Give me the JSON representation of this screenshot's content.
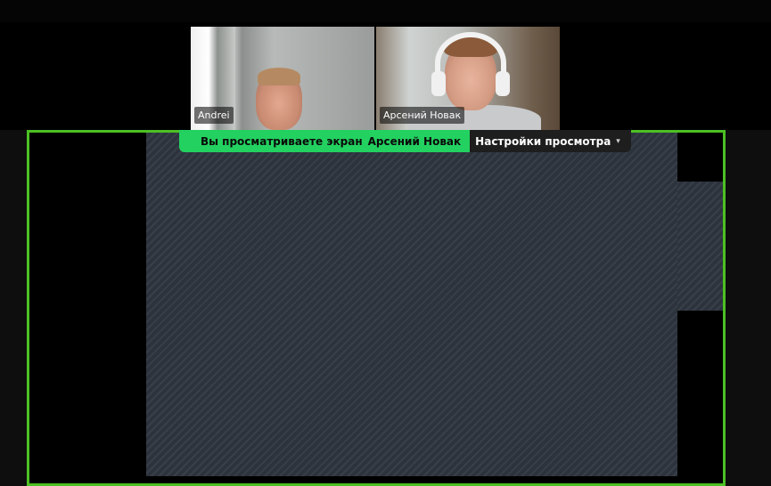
{
  "participants": [
    {
      "name": "Andrei"
    },
    {
      "name": "Арсений Новак"
    }
  ],
  "share_banner": {
    "status_text": "Вы просматриваете экран",
    "sharer_name": "Арсений Новак",
    "view_options_label": "Настройки просмотра"
  },
  "colors": {
    "share_border": "#4cc024",
    "banner_green": "#23d160",
    "banner_dark": "#1e1e1e",
    "shared_screen_bg": "#2c333d"
  }
}
